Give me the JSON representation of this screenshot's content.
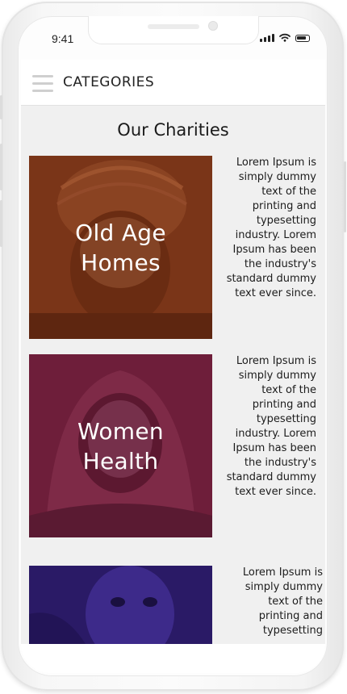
{
  "status_bar": {
    "time": "9:41"
  },
  "header": {
    "title": "CATEGORIES"
  },
  "section": {
    "title": "Our Charities"
  },
  "charities": [
    {
      "label_line1": "Old Age",
      "label_line2": "Homes",
      "tint": "#7a3518",
      "description": "Lorem Ipsum is simply dummy text of the printing and typesetting industry. Lorem Ipsum has been the industry's standard dummy text ever since."
    },
    {
      "label_line1": "Women",
      "label_line2": "Health",
      "tint": "#6e1e3a",
      "description": "Lorem Ipsum is simply dummy text of the printing and typesetting industry. Lorem Ipsum has been the industry's standard dummy text ever since."
    },
    {
      "label_line1": "",
      "label_line2": "",
      "tint": "#3a1f7a",
      "description": "Lorem Ipsum is simply dummy text of the printing and typesetting"
    }
  ]
}
